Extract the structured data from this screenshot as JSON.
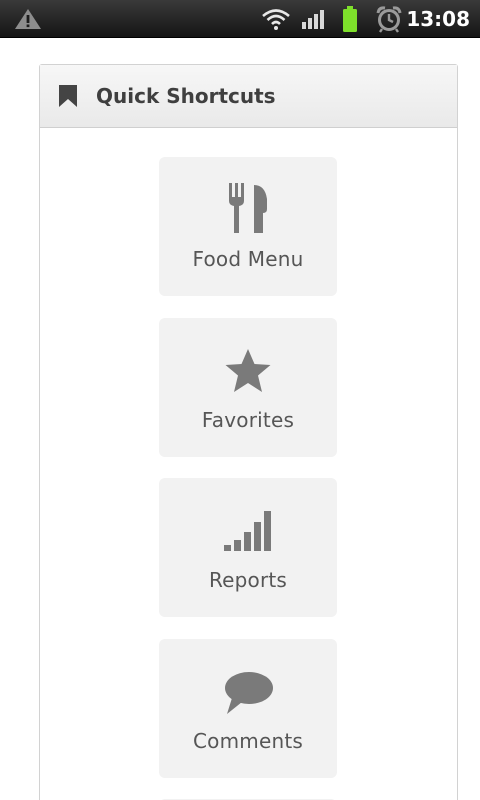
{
  "status_bar": {
    "time": "13:08",
    "icons": [
      "warning-icon",
      "wifi-icon",
      "signal-icon",
      "battery-icon",
      "alarm-icon"
    ],
    "battery_color": "#7ee02b"
  },
  "panel": {
    "title": "Quick Shortcuts",
    "icon": "bookmark-icon"
  },
  "shortcuts": [
    {
      "label": "Food Menu",
      "icon": "cutlery-icon"
    },
    {
      "label": "Favorites",
      "icon": "star-icon"
    },
    {
      "label": "Reports",
      "icon": "signal-bars-icon"
    },
    {
      "label": "Comments",
      "icon": "speech-bubble-icon"
    }
  ],
  "colors": {
    "icon_gray": "#7a7a7a",
    "tile_bg": "#f2f2f2",
    "text": "#565656"
  }
}
